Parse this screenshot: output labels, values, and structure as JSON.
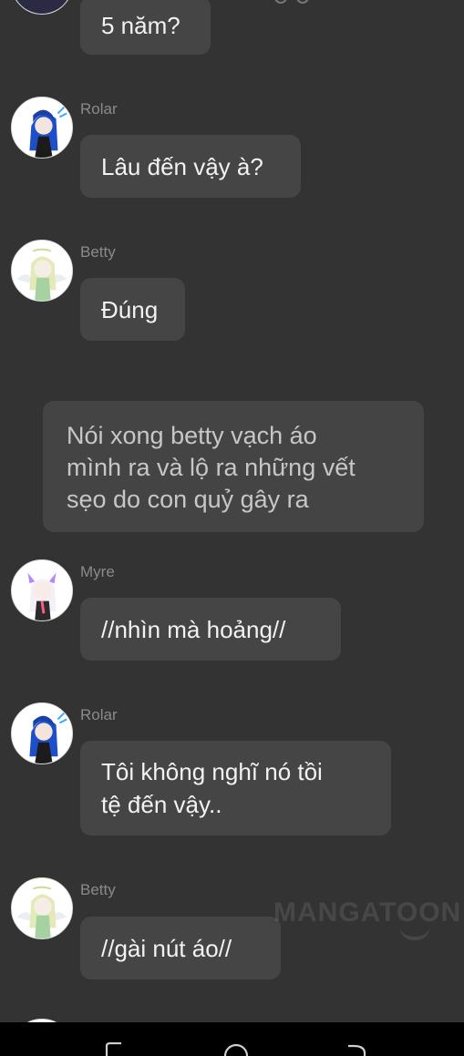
{
  "messages": [
    {
      "sender": "",
      "text": "5 năm?"
    },
    {
      "sender": "Rolar",
      "text": "Lâu đến vậy à?"
    },
    {
      "sender": "Betty",
      "text": "Đúng"
    },
    {
      "sender": "Myre",
      "text": "//nhìn mà hoảng//"
    },
    {
      "sender": "Rolar",
      "text_line1": "Tôi không nghĩ nó tồi",
      "text_line2": "tệ đến vậy.."
    },
    {
      "sender": "Betty",
      "text": "//gài nút áo//"
    }
  ],
  "narration": {
    "line1": "Nói xong betty vạch áo",
    "line2": "mình ra và lộ ra những vết",
    "line3": "sẹo do con quỷ gây ra"
  },
  "watermark": "MANGATOON",
  "avatars": {
    "rolar": {
      "hair": "#1f4fc8",
      "accent": "#35a8ff"
    },
    "betty": {
      "hair": "#e3eab8",
      "accent": "#a5d2a0"
    },
    "myre": {
      "hair": "#ffffff",
      "accent": "#b388ff"
    }
  },
  "navbar": {
    "icons": [
      "recent-apps-icon",
      "home-icon",
      "back-icon"
    ]
  }
}
